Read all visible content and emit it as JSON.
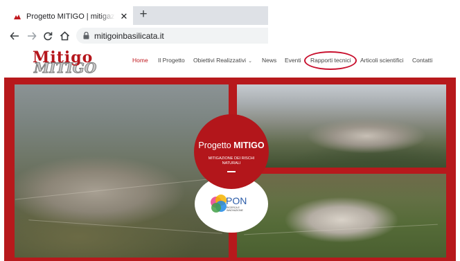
{
  "browser": {
    "tab_title": "Progetto MITIGO | mitigazione de",
    "url": "mitigoinbasilicata.it"
  },
  "site": {
    "logo_top": "Mitigo",
    "logo_bottom": "MITIGO",
    "menu": {
      "home": "Home",
      "progetto": "Il Progetto",
      "obiettivi": "Obiettivi Realizzativi",
      "news": "News",
      "eventi": "Eventi",
      "rapporti": "Rapporti tecnici",
      "articoli": "Articoli scientifici",
      "contatti": "Contatti"
    }
  },
  "hero": {
    "circle_title_prefix": "Progetto ",
    "circle_title_bold": "MITIGO",
    "circle_subtitle": "MITIGAZIONE DEI RISCHI NATURALI",
    "pon_label": "PON",
    "pon_sub": "RICERCA E INNOVAZIONE"
  },
  "colors": {
    "brand_red": "#b7191c",
    "highlight": "#c8102e"
  },
  "icons": {
    "tab_favicon": "mitigo-favicon-icon",
    "tab_close": "close-icon",
    "new_tab": "plus-icon",
    "back": "back-arrow-icon",
    "forward": "forward-arrow-icon",
    "reload": "reload-icon",
    "home": "home-icon",
    "lock": "lock-icon"
  }
}
